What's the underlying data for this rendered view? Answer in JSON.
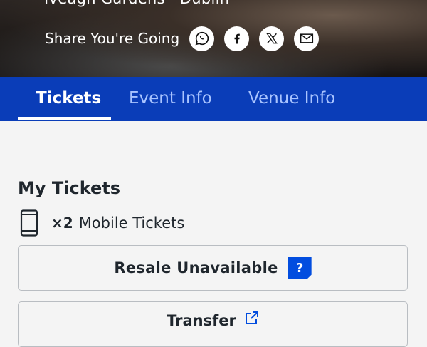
{
  "hero": {
    "venue": "Iveagh Gardens · Dublin",
    "share_label": "Share You're Going",
    "share_buttons": [
      {
        "name": "whatsapp-icon"
      },
      {
        "name": "facebook-icon"
      },
      {
        "name": "x-icon"
      },
      {
        "name": "email-icon"
      }
    ]
  },
  "tabs": [
    {
      "label": "Tickets",
      "active": true
    },
    {
      "label": "Event Info",
      "active": false
    },
    {
      "label": "Venue Info",
      "active": false
    }
  ],
  "my_tickets": {
    "title": "My Tickets",
    "qty": "×2",
    "label": "Mobile Tickets",
    "icon": "mobile-phone-icon"
  },
  "buttons": {
    "resale": "Resale Unavailable",
    "help": "?",
    "transfer": "Transfer"
  },
  "colors": {
    "brand_blue": "#0a3db8",
    "badge_blue": "#024ddf",
    "inactive_tab": "#a9c4ff"
  }
}
